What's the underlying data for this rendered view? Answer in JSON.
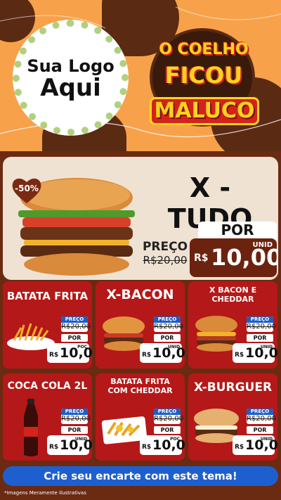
{
  "header": {
    "logo_line1": "Sua Logo",
    "logo_line2": "Aqui",
    "title_line1": "O COELHO",
    "title_line2": "FICOU",
    "title_line3": "MALUCO"
  },
  "featured": {
    "discount": "-50%",
    "name": "X - TUDO",
    "preco_label": "PREÇO",
    "old_price": "R$20,00",
    "por_label": "POR",
    "currency": "R$",
    "price": "10,00",
    "unit": "UNID"
  },
  "products": [
    {
      "name": "BATATA FRITA",
      "preco_label": "PREÇO",
      "old_price": "R$20,00",
      "por_label": "POR",
      "currency": "R$",
      "price": "10,00",
      "unit": "POÇ"
    },
    {
      "name": "X-BACON",
      "preco_label": "PREÇO",
      "old_price": "R$20,00",
      "por_label": "POR",
      "currency": "R$",
      "price": "10,00",
      "unit": "UNID"
    },
    {
      "name": "X BACON E CHEDDAR",
      "preco_label": "PREÇO",
      "old_price": "R$20,00",
      "por_label": "POR",
      "currency": "R$",
      "price": "10,00",
      "unit": "UNID"
    },
    {
      "name": "COCA COLA 2L",
      "preco_label": "PREÇO",
      "old_price": "R$20,00",
      "por_label": "POR",
      "currency": "R$",
      "price": "10,00",
      "unit": "UNID"
    },
    {
      "name": "BATATA FRITA COM CHEDDAR",
      "preco_label": "PREÇO",
      "old_price": "R$20,00",
      "por_label": "POR",
      "currency": "R$",
      "price": "10,00",
      "unit": "POÇ"
    },
    {
      "name": "X-BURGUER",
      "preco_label": "PREÇO",
      "old_price": "R$20,00",
      "por_label": "POR",
      "currency": "R$",
      "price": "10,00",
      "unit": "UNID"
    }
  ],
  "cta": "Crie seu encarte com este tema!",
  "disclaimer": "*Imagens Meramente Ilustrativas",
  "colors": {
    "background_orange": "#f7a24a",
    "brown": "#6b2a12",
    "card_red": "#b51818",
    "cta_blue": "#1e5fd0",
    "title_yellow": "#ffd21f"
  }
}
